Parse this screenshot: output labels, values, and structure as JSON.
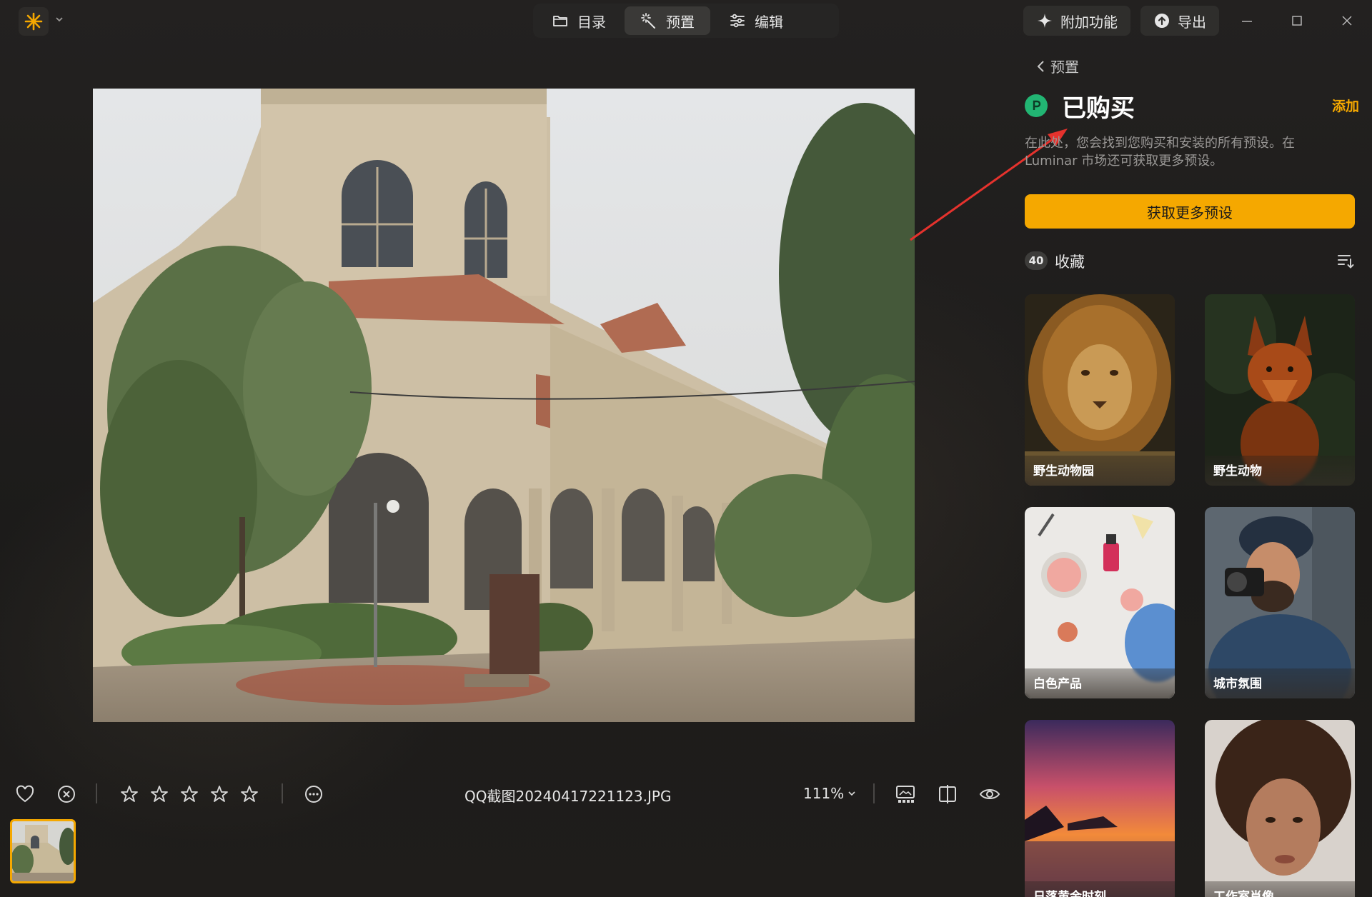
{
  "topbar": {
    "modes": [
      {
        "label": "目录",
        "icon": "folder-icon"
      },
      {
        "label": "预置",
        "icon": "magic-wand-icon",
        "active": true
      },
      {
        "label": "编辑",
        "icon": "sliders-icon"
      }
    ],
    "addons_label": "附加功能",
    "export_label": "导出"
  },
  "bottom": {
    "filename": "QQ截图20240417221123.JPG",
    "zoom": "111%",
    "rating": 0,
    "rating_max": 5
  },
  "panel": {
    "back_label": "预置",
    "title": "已购买",
    "add_label": "添加",
    "description": "在此处，您会找到您购买和安装的所有预设。在 Luminar 市场还可获取更多预设。",
    "get_more_label": "获取更多预设",
    "favorites_count": "40",
    "favorites_label": "收藏",
    "presets": [
      {
        "label": "野生动物园",
        "art": "lion"
      },
      {
        "label": "野生动物",
        "art": "fox"
      },
      {
        "label": "白色产品",
        "art": "cosmetics"
      },
      {
        "label": "城市氛围",
        "art": "photographer"
      },
      {
        "label": "日落黄金时刻",
        "art": "sunset"
      },
      {
        "label": "工作室肖像",
        "art": "portrait"
      }
    ]
  },
  "colors": {
    "accent": "#f5a800",
    "panel_bg": "#1b1a19",
    "badge_green": "#22b573"
  }
}
